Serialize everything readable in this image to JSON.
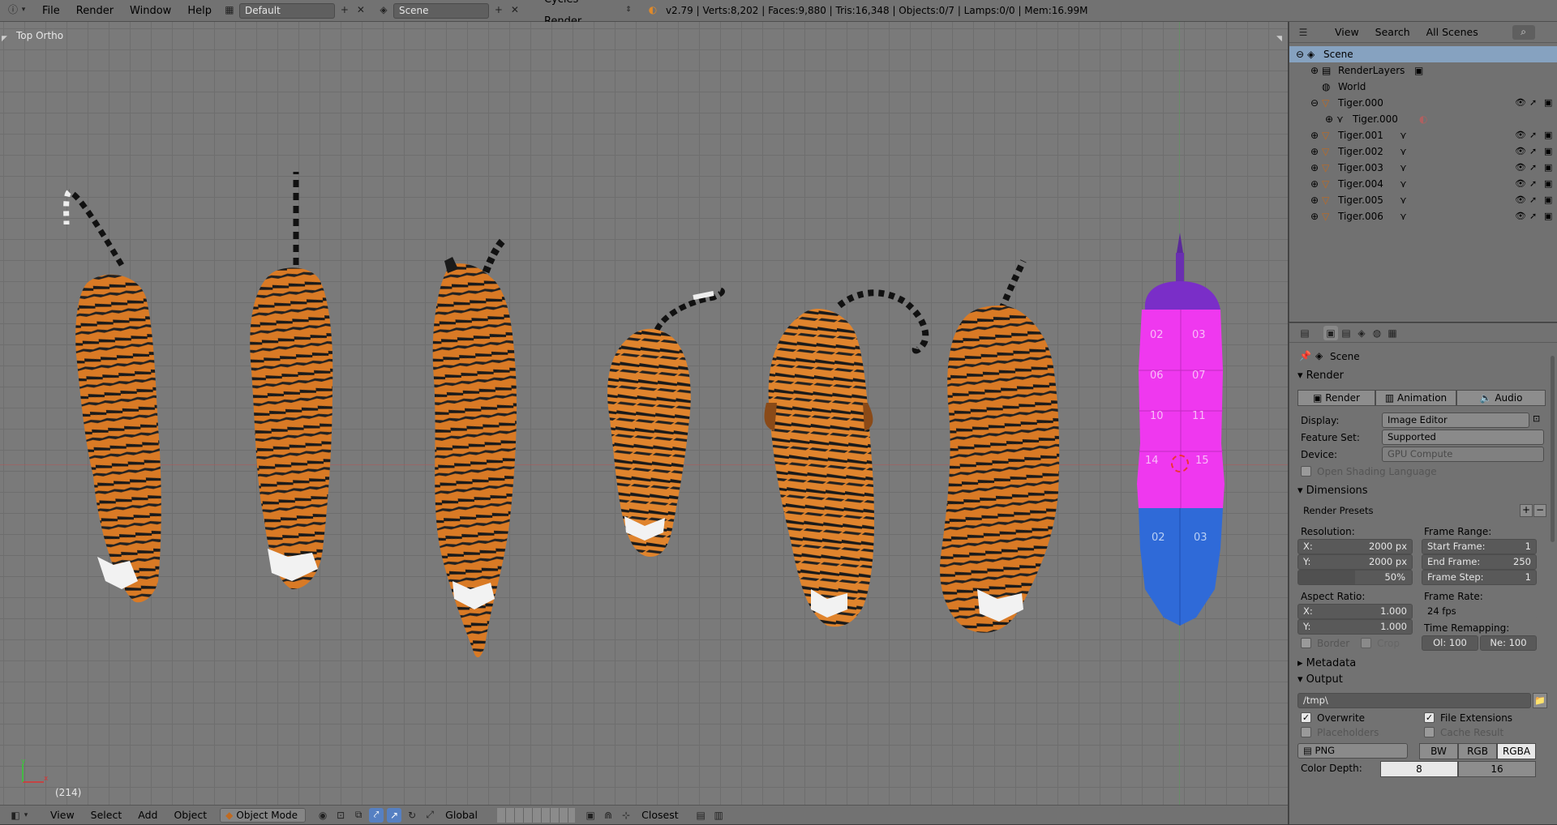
{
  "topbar": {
    "menus": [
      "File",
      "Render",
      "Window",
      "Help"
    ],
    "layout": "Default",
    "scene": "Scene",
    "engine": "Cycles Render",
    "info": "v2.79 | Verts:8,202 | Faces:9,880 | Tris:16,348 | Objects:0/7 | Lamps:0/0 | Mem:16.99M"
  },
  "viewport": {
    "view_label": "Top Ortho",
    "frame_label": "(214)"
  },
  "vp_header": {
    "menus": [
      "View",
      "Select",
      "Add",
      "Object"
    ],
    "mode": "Object Mode",
    "orientation": "Global",
    "snap": "Closest"
  },
  "outliner": {
    "menus": [
      "View",
      "Search"
    ],
    "display": "All Scenes",
    "rows": [
      {
        "label": "Scene"
      },
      {
        "label": "RenderLayers"
      },
      {
        "label": "World"
      },
      {
        "label": "Tiger.000"
      },
      {
        "label": "Tiger.000"
      },
      {
        "label": "Tiger.001"
      },
      {
        "label": "Tiger.002"
      },
      {
        "label": "Tiger.003"
      },
      {
        "label": "Tiger.004"
      },
      {
        "label": "Tiger.005"
      },
      {
        "label": "Tiger.006"
      }
    ]
  },
  "props": {
    "context": "Scene",
    "render": {
      "title": "Render",
      "tabs": [
        "Render",
        "Animation",
        "Audio"
      ],
      "display_label": "Display:",
      "display_value": "Image Editor",
      "feature_label": "Feature Set:",
      "feature_value": "Supported",
      "device_label": "Device:",
      "device_value": "GPU Compute",
      "osl": "Open Shading Language"
    },
    "dimensions": {
      "title": "Dimensions",
      "presets": "Render Presets",
      "resolution_label": "Resolution:",
      "res_x_label": "X:",
      "res_x": "2000 px",
      "res_y_label": "Y:",
      "res_y": "2000 px",
      "res_pct": "50%",
      "res_pct_value": 0.5,
      "frame_range_label": "Frame Range:",
      "start_label": "Start Frame:",
      "start": "1",
      "end_label": "End Frame:",
      "end": "250",
      "step_label": "Frame Step:",
      "step": "1",
      "aspect_label": "Aspect Ratio:",
      "asp_x_label": "X:",
      "asp_x": "1.000",
      "asp_y_label": "Y:",
      "asp_y": "1.000",
      "frame_rate_label": "Frame Rate:",
      "frame_rate": "24 fps",
      "remap_label": "Time Remapping:",
      "remap_old": "Ol: 100",
      "remap_new": "Ne: 100",
      "border": "Border",
      "crop": "Crop"
    },
    "metadata": {
      "title": "Metadata"
    },
    "output": {
      "title": "Output",
      "path": "/tmp\\",
      "overwrite": "Overwrite",
      "file_ext": "File Extensions",
      "placeholders": "Placeholders",
      "cache": "Cache Result",
      "format": "PNG",
      "color_modes": [
        "BW",
        "RGB",
        "RGBA"
      ],
      "color_depth_label": "Color Depth:",
      "depths": [
        "8",
        "16"
      ]
    }
  }
}
